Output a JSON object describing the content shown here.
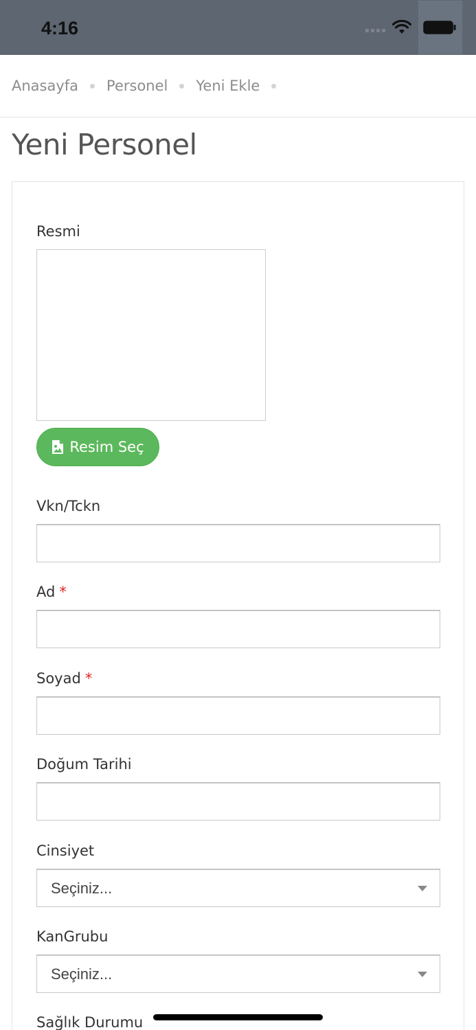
{
  "status_bar": {
    "time": "4:16",
    "icons": [
      "cellular-signal-icon",
      "wifi-icon",
      "battery-icon"
    ]
  },
  "breadcrumb": {
    "items": [
      "Anasayfa",
      "Personel",
      "Yeni Ekle"
    ]
  },
  "page": {
    "title": "Yeni Personel"
  },
  "form": {
    "photo": {
      "label": "Resmi",
      "button_label": "Resim Seç",
      "button_icon": "image-icon"
    },
    "fields": {
      "vkn": {
        "label": "Vkn/Tckn",
        "value": ""
      },
      "ad": {
        "label": "Ad",
        "required_mark": "*",
        "value": ""
      },
      "soyad": {
        "label": "Soyad",
        "required_mark": "*",
        "value": ""
      },
      "dogum_tarihi": {
        "label": "Doğum Tarihi",
        "value": ""
      },
      "cinsiyet": {
        "label": "Cinsiyet",
        "selected": "Seçiniz..."
      },
      "kan_grubu": {
        "label": "KanGrubu",
        "selected": "Seçiniz..."
      },
      "saglik_durumu": {
        "label": "Sağlık Durumu"
      }
    }
  },
  "colors": {
    "status_bar": "#5e6671",
    "success_button": "#5cb85c",
    "required": "#e02424",
    "border": "#c8c8c8"
  }
}
